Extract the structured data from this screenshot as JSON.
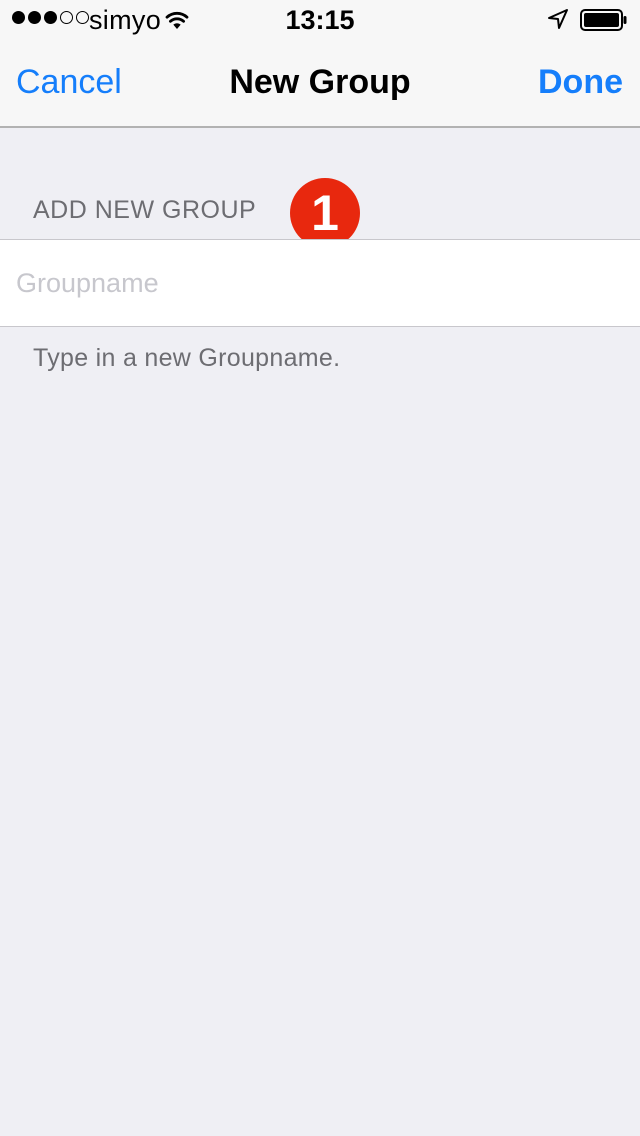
{
  "status_bar": {
    "carrier": "simyo",
    "time": "13:15",
    "signal_bars_filled": 3,
    "signal_bars_total": 5,
    "icons": [
      "wifi-icon",
      "location-arrow-icon",
      "battery-icon"
    ]
  },
  "nav": {
    "cancel_label": "Cancel",
    "title": "New Group",
    "done_label": "Done"
  },
  "form": {
    "section_header": "ADD NEW GROUP",
    "step_badge": "1",
    "groupname_placeholder": "Groupname",
    "groupname_value": "",
    "footer_hint": "Type in a new Groupname."
  },
  "colors": {
    "accent": "#157efb",
    "background": "#efeff4",
    "badge": "#e8280e"
  }
}
